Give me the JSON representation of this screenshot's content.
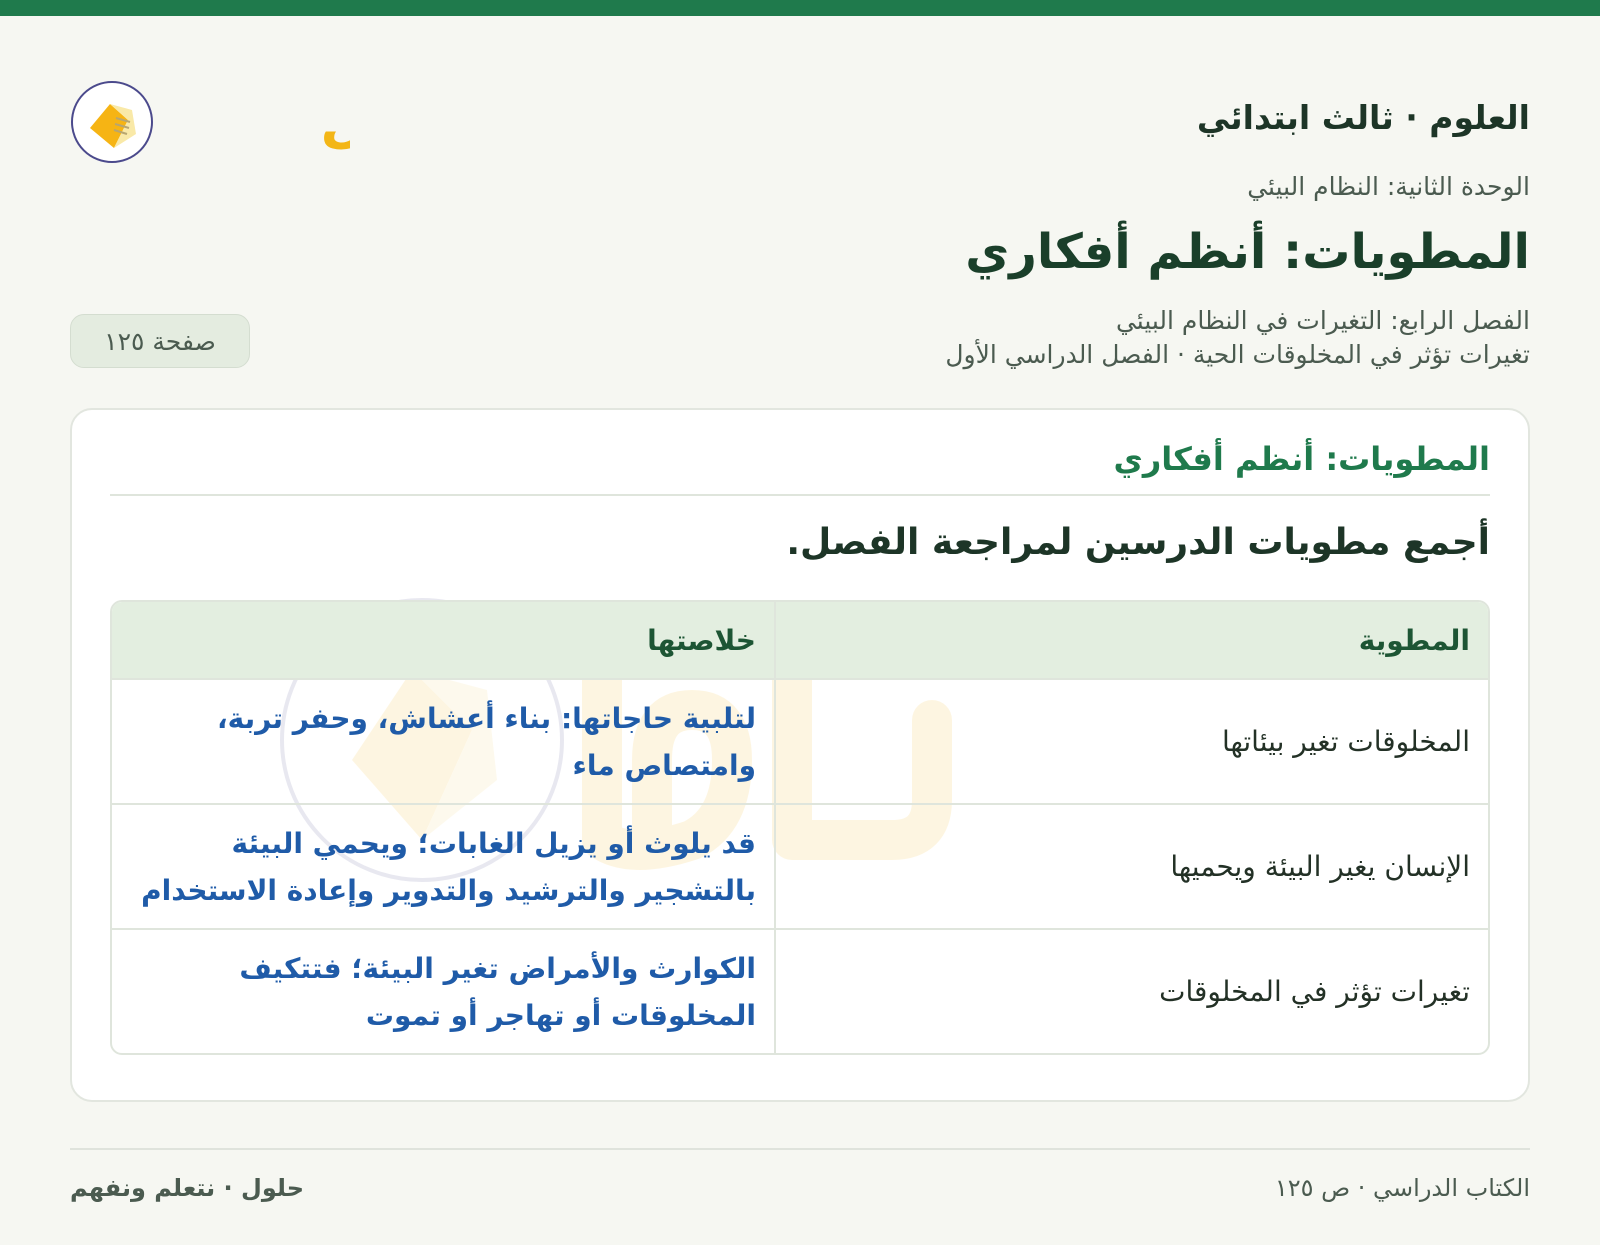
{
  "header": {
    "subject_title": "العلوم · ثالث ابتدائي",
    "logo_text": "حلول"
  },
  "meta": {
    "unit": "الوحدة الثانية: النظام البيئي",
    "title": "المطويات: أنظم أفكاري",
    "chapter": "الفصل الرابع: التغيرات في النظام البيئي",
    "lesson": "تغيرات تؤثر في المخلوقات الحية · الفصل الدراسي الأول",
    "page_badge": "صفحة ١٢٥"
  },
  "card": {
    "heading": "المطويات: أنظم أفكاري",
    "instruction": "أجمع مطويات الدرسين لمراجعة الفصل.",
    "table": {
      "headers": {
        "fold": "المطوية",
        "summary": "خلاصتها"
      },
      "rows": [
        {
          "fold": "المخلوقات تغير بيئاتها",
          "summary": "لتلبية حاجاتها: بناء أعشاش، وحفر تربة، وامتصاص ماء"
        },
        {
          "fold": "الإنسان يغير البيئة ويحميها",
          "summary": "قد يلوث أو يزيل الغابات؛ ويحمي البيئة بالتشجير والترشيد والتدوير وإعادة الاستخدام"
        },
        {
          "fold": "تغيرات تؤثر في المخلوقات",
          "summary": "الكوارث والأمراض تغير البيئة؛ فتتكيف المخلوقات أو تهاجر أو تموت"
        }
      ]
    }
  },
  "footer": {
    "left": "حلول · نتعلم ونفهم",
    "right": "الكتاب الدراسي · ص ١٢٥"
  },
  "colors": {
    "accent": "#1f7a4c",
    "summary_text": "#1f5ba8",
    "logo_gold": "#f3b616"
  }
}
